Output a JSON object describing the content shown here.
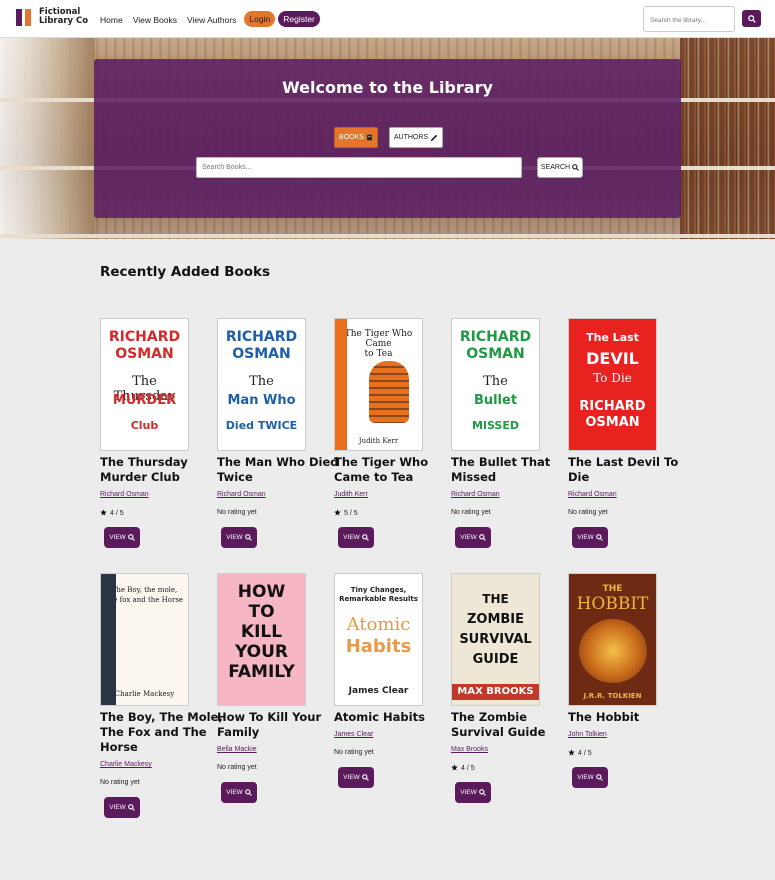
{
  "navbar": {
    "logo_line1": "Fictional",
    "logo_line2": "Library Co",
    "links": [
      "Home",
      "View Books",
      "View Authors"
    ],
    "login_label": "Login",
    "register_label": "Register",
    "search_placeholder": "Search the library..."
  },
  "hero": {
    "title": "Welcome to the Library",
    "tab_books": "BOOKS",
    "tab_authors": "AUTHORS",
    "search_placeholder": "Search Books...",
    "search_button": "SEARCH"
  },
  "section_title": "Recently Added Books",
  "view_label": "VIEW",
  "books": [
    {
      "title": "The Thursday Murder Club",
      "author": "Richard Osman",
      "rating": "4 / 5",
      "cover": {
        "bg": "#ffffff",
        "accent": "#d32a2a",
        "line1": "RICHARD",
        "line2": "OSMAN",
        "line3": "The Thursday",
        "line4": "MURDER",
        "line5": "Club"
      }
    },
    {
      "title": "The Man Who Died Twice",
      "author": "Richard Osman",
      "rating": "No rating yet",
      "cover": {
        "bg": "#ffffff",
        "accent": "#1d5fa8",
        "line1": "RICHARD",
        "line2": "OSMAN",
        "line3": "The",
        "line4": "Man Who",
        "line5": "Died TWICE"
      }
    },
    {
      "title": "The Tiger Who Came to Tea",
      "author": "Judith Kerr",
      "rating": "5 / 5",
      "cover": {
        "bg": "#ffffff",
        "accent": "#e86f1c",
        "line1": "The Tiger Who",
        "line2": "Came",
        "line3": "to Tea",
        "line4": "",
        "line5": "Judith Kerr"
      }
    },
    {
      "title": "The Bullet That Missed",
      "author": "Richard Osman",
      "rating": "No rating yet",
      "cover": {
        "bg": "#ffffff",
        "accent": "#1f9a43",
        "line1": "RICHARD",
        "line2": "OSMAN",
        "line3": "The",
        "line4": "Bullet",
        "line5": "MISSED"
      }
    },
    {
      "title": "The Last Devil To Die",
      "author": "Richard Osman",
      "rating": "No rating yet",
      "cover": {
        "bg": "#e8221f",
        "accent": "#ffffff",
        "line1": "The Last",
        "line2": "DEVIL",
        "line3": "To Die",
        "line4": "RICHARD",
        "line5": "OSMAN"
      }
    },
    {
      "title": "The Boy, The Mole, The Fox and The Horse",
      "author": "Charlie Mackesy",
      "rating": "No rating yet",
      "cover": {
        "bg": "#fbf7ef",
        "accent": "#2b3444",
        "line1": "The Boy, the mole,",
        "line2": "the fox and the Horse",
        "line3": "",
        "line4": "",
        "line5": "Charlie Mackesy"
      }
    },
    {
      "title": "How To Kill Your Family",
      "author": "Bella Mackie",
      "rating": "No rating yet",
      "cover": {
        "bg": "#f7b6c4",
        "accent": "#111111",
        "line1": "HOW",
        "line2": "TO",
        "line3": "KILL",
        "line4": "YOUR",
        "line5": "FAMILY"
      }
    },
    {
      "title": "Atomic Habits",
      "author": "James Clear",
      "rating": "No rating yet",
      "cover": {
        "bg": "#ffffff",
        "accent": "#e59b46",
        "line1": "Tiny Changes,",
        "line2": "Remarkable Results",
        "line3": "Atomic",
        "line4": "Habits",
        "line5": "James Clear"
      }
    },
    {
      "title": "The Zombie Survival Guide",
      "author": "Max Brooks",
      "rating": "4 / 5",
      "cover": {
        "bg": "#efe7d6",
        "accent": "#c0392b",
        "line1": "THE",
        "line2": "ZOMBIE",
        "line3": "SURVIVAL",
        "line4": "GUIDE",
        "line5": "MAX BROOKS"
      }
    },
    {
      "title": "The Hobbit",
      "author": "John Tolkien",
      "rating": "4 / 5",
      "cover": {
        "bg": "#6e2a12",
        "accent": "#f2b63a",
        "line1": "THE",
        "line2": "HOBBIT",
        "line3": "",
        "line4": "",
        "line5": "J.R.R. TOLKIEN"
      }
    }
  ]
}
